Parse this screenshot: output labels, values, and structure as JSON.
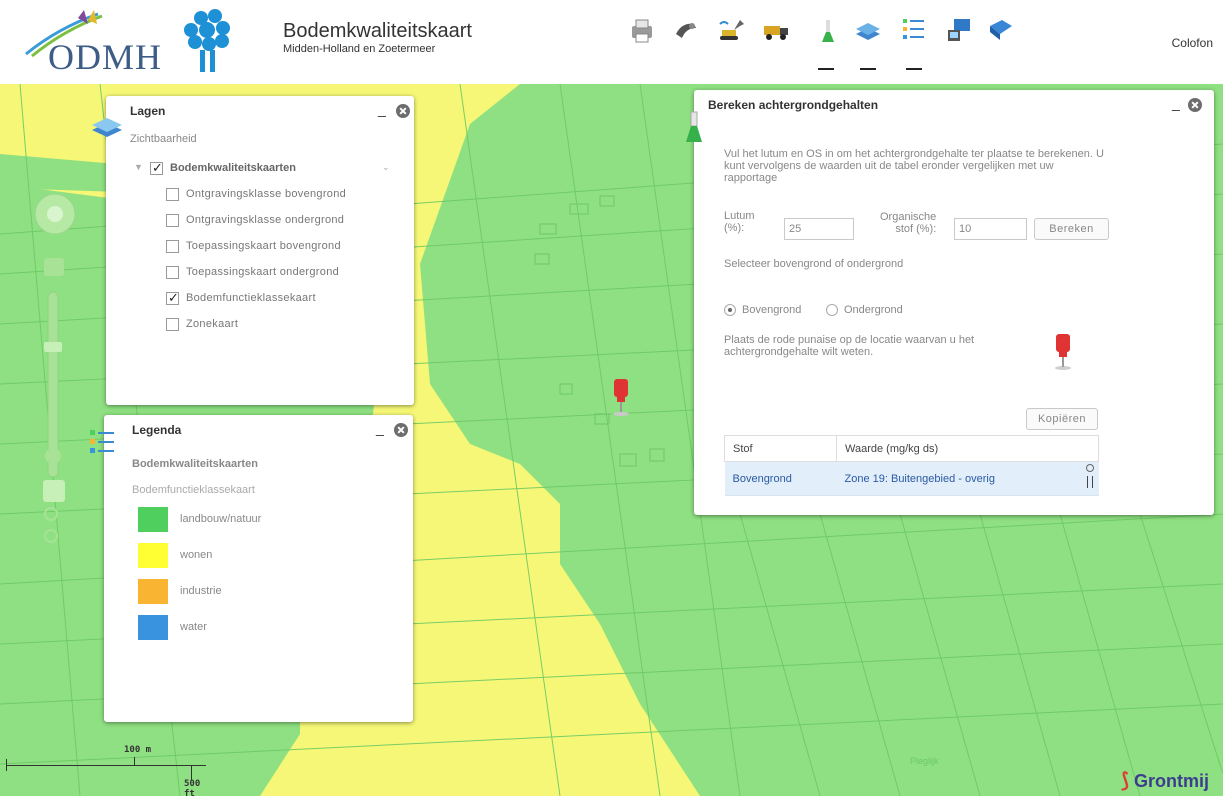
{
  "header": {
    "org_logo_text": "ODMH",
    "title": "Bodemkwaliteitskaart",
    "subtitle": "Midden-Holland en Zoetermeer",
    "colofon_label": "Colofon",
    "toolbar_icons": [
      "print-icon",
      "drill-icon",
      "excavator-icon",
      "truck-icon",
      "flask-icon",
      "layers-icon",
      "legend-list-icon",
      "pc-icon",
      "book-icon"
    ]
  },
  "lagen": {
    "title": "Lagen",
    "zichtbaarheid_label": "Zichtbaarheid",
    "group_label": "Bodemkwaliteitskaarten",
    "group_checked": true,
    "layers": [
      {
        "label": "Ontgravingsklasse bovengrond",
        "checked": false
      },
      {
        "label": "Ontgravingsklasse ondergrond",
        "checked": false
      },
      {
        "label": "Toepassingskaart bovengrond",
        "checked": false
      },
      {
        "label": "Toepassingskaart ondergrond",
        "checked": false
      },
      {
        "label": "Bodemfunctieklassekaart",
        "checked": true
      },
      {
        "label": "Zonekaart",
        "checked": false
      }
    ],
    "minimize": "_"
  },
  "legenda": {
    "title": "Legenda",
    "group_title": "Bodemkwaliteitskaarten",
    "sub_title": "Bodemfunctieklassekaart",
    "items": [
      {
        "label": "landbouw/natuur",
        "color": "#4fcf5e"
      },
      {
        "label": "wonen",
        "color": "#ffff33"
      },
      {
        "label": "industrie",
        "color": "#f9b532"
      },
      {
        "label": "water",
        "color": "#3993df"
      }
    ],
    "minimize": "_"
  },
  "bereken": {
    "title": "Bereken achtergrondgehalten",
    "intro": "Vul het lutum en OS in om het achtergrondgehalte ter plaatse te berekenen. U kunt vervolgens de waarden uit de tabel eronder vergelijken met uw rapportage",
    "lutum_label_1": "Lutum",
    "lutum_label_2": "(%):",
    "lutum_value": "25",
    "os_label_1": "Organische",
    "os_label_2": "stof (%):",
    "os_value": "10",
    "bereken_button": "Bereken",
    "select_text": "Selecteer bovengrond of ondergrond",
    "radio_boven": "Bovengrond",
    "radio_onder": "Ondergrond",
    "selected_radio": "Bovengrond",
    "punaise_text": "Plaats de rode punaise op de locatie waarvan u het achtergrondgehalte wilt weten.",
    "kopieren_button": "Kopiëren",
    "table": {
      "headers": [
        "Stof",
        "Waarde (mg/kg ds)"
      ],
      "rows": [
        [
          "Bovengrond",
          "Zone 19: Buitengebied - overig"
        ]
      ]
    },
    "minimize": "_"
  },
  "map": {
    "scale_metric": "100 m",
    "scale_imperial": "500 ft",
    "road_label": "Pleglijk",
    "attribution": "Grontmij"
  }
}
